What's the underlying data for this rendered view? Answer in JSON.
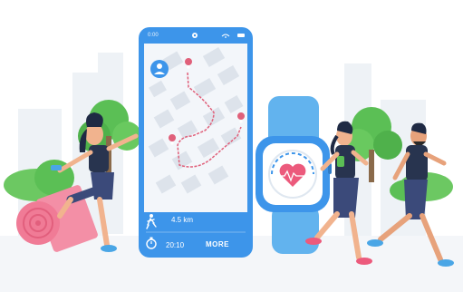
{
  "phone": {
    "status_time": "0:00",
    "distance": "4.5 km",
    "timer": "20:10",
    "more_label": "MORE"
  },
  "icons": [
    "user-icon",
    "running-icon",
    "stopwatch-icon",
    "heart-rate-icon",
    "wifi-icon",
    "battery-icon"
  ],
  "colors": {
    "phone_blue": "#3d95ea",
    "route_pink": "#e0607a",
    "watch_blue": "#62b3ee",
    "heart_pink": "#ec5a7c",
    "tree_green": "#5bbf55",
    "top_navy": "#28344f",
    "shorts_blue": "#3b4a7a"
  }
}
